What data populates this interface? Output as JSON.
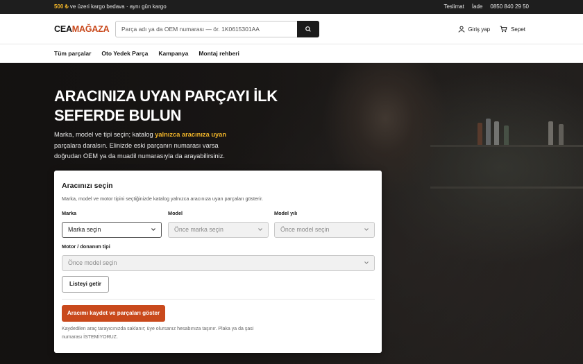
{
  "topbar": {
    "promo_amount": "500 ₺",
    "promo_text": " ve üzeri kargo bedava · aynı gün kargo",
    "links": [
      "Teslimat",
      "İade",
      "0850 840 29 50"
    ]
  },
  "header": {
    "logo_part1": "CEA",
    "logo_part2": "MAĞAZA",
    "search_placeholder": "Parça adı ya da OEM numarası — ör. 1K0615301AA",
    "search_icon": "search-icon",
    "login_label": "Giriş yap",
    "login_icon": "user-icon",
    "cart_label": "Sepet",
    "cart_icon": "cart-icon"
  },
  "nav": {
    "items": [
      "Tüm parçalar",
      "Oto Yedek Parça",
      "Kampanya",
      "Montaj rehberi"
    ]
  },
  "hero": {
    "title": "ARACINIZA UYAN PARÇAYI İLK SEFERDE BULUN",
    "desc_before": "Marka, model ve tipi seçin; katalog ",
    "desc_highlight": "yalnızca aracınıza uyan",
    "desc_after": " parçalara daralsın. Elinizde eski parçanın numarası varsa doğrudan OEM ya da muadil numarasıyla da arayabilirsiniz."
  },
  "selector": {
    "title": "Aracınızı seçin",
    "subtitle": "Marka, model ve motor tipini seçtiğinizde katalog yalnızca aracınıza uyan parçaları gösterir.",
    "brand_label": "Marka",
    "brand_value": "Marka seçin",
    "model_label": "Model",
    "model_value": "Önce marka seçin",
    "year_label": "Model yılı",
    "year_value": "Önce model seçin",
    "engine_label": "Motor / donanım tipi",
    "engine_value": "Önce model seçin",
    "list_button": "Listeyi getir",
    "save_button": "Aracımı kaydet ve parçaları göster",
    "note": "Kaydedilen araç tarayıcınızda saklanır; üye olursanız hesabınıza taşınır. Plaka ya da şasi numarası İSTEMİYORUZ."
  },
  "colors": {
    "accent": "#c9491c",
    "highlight": "#f0b429",
    "dark": "#1b1b1b"
  }
}
